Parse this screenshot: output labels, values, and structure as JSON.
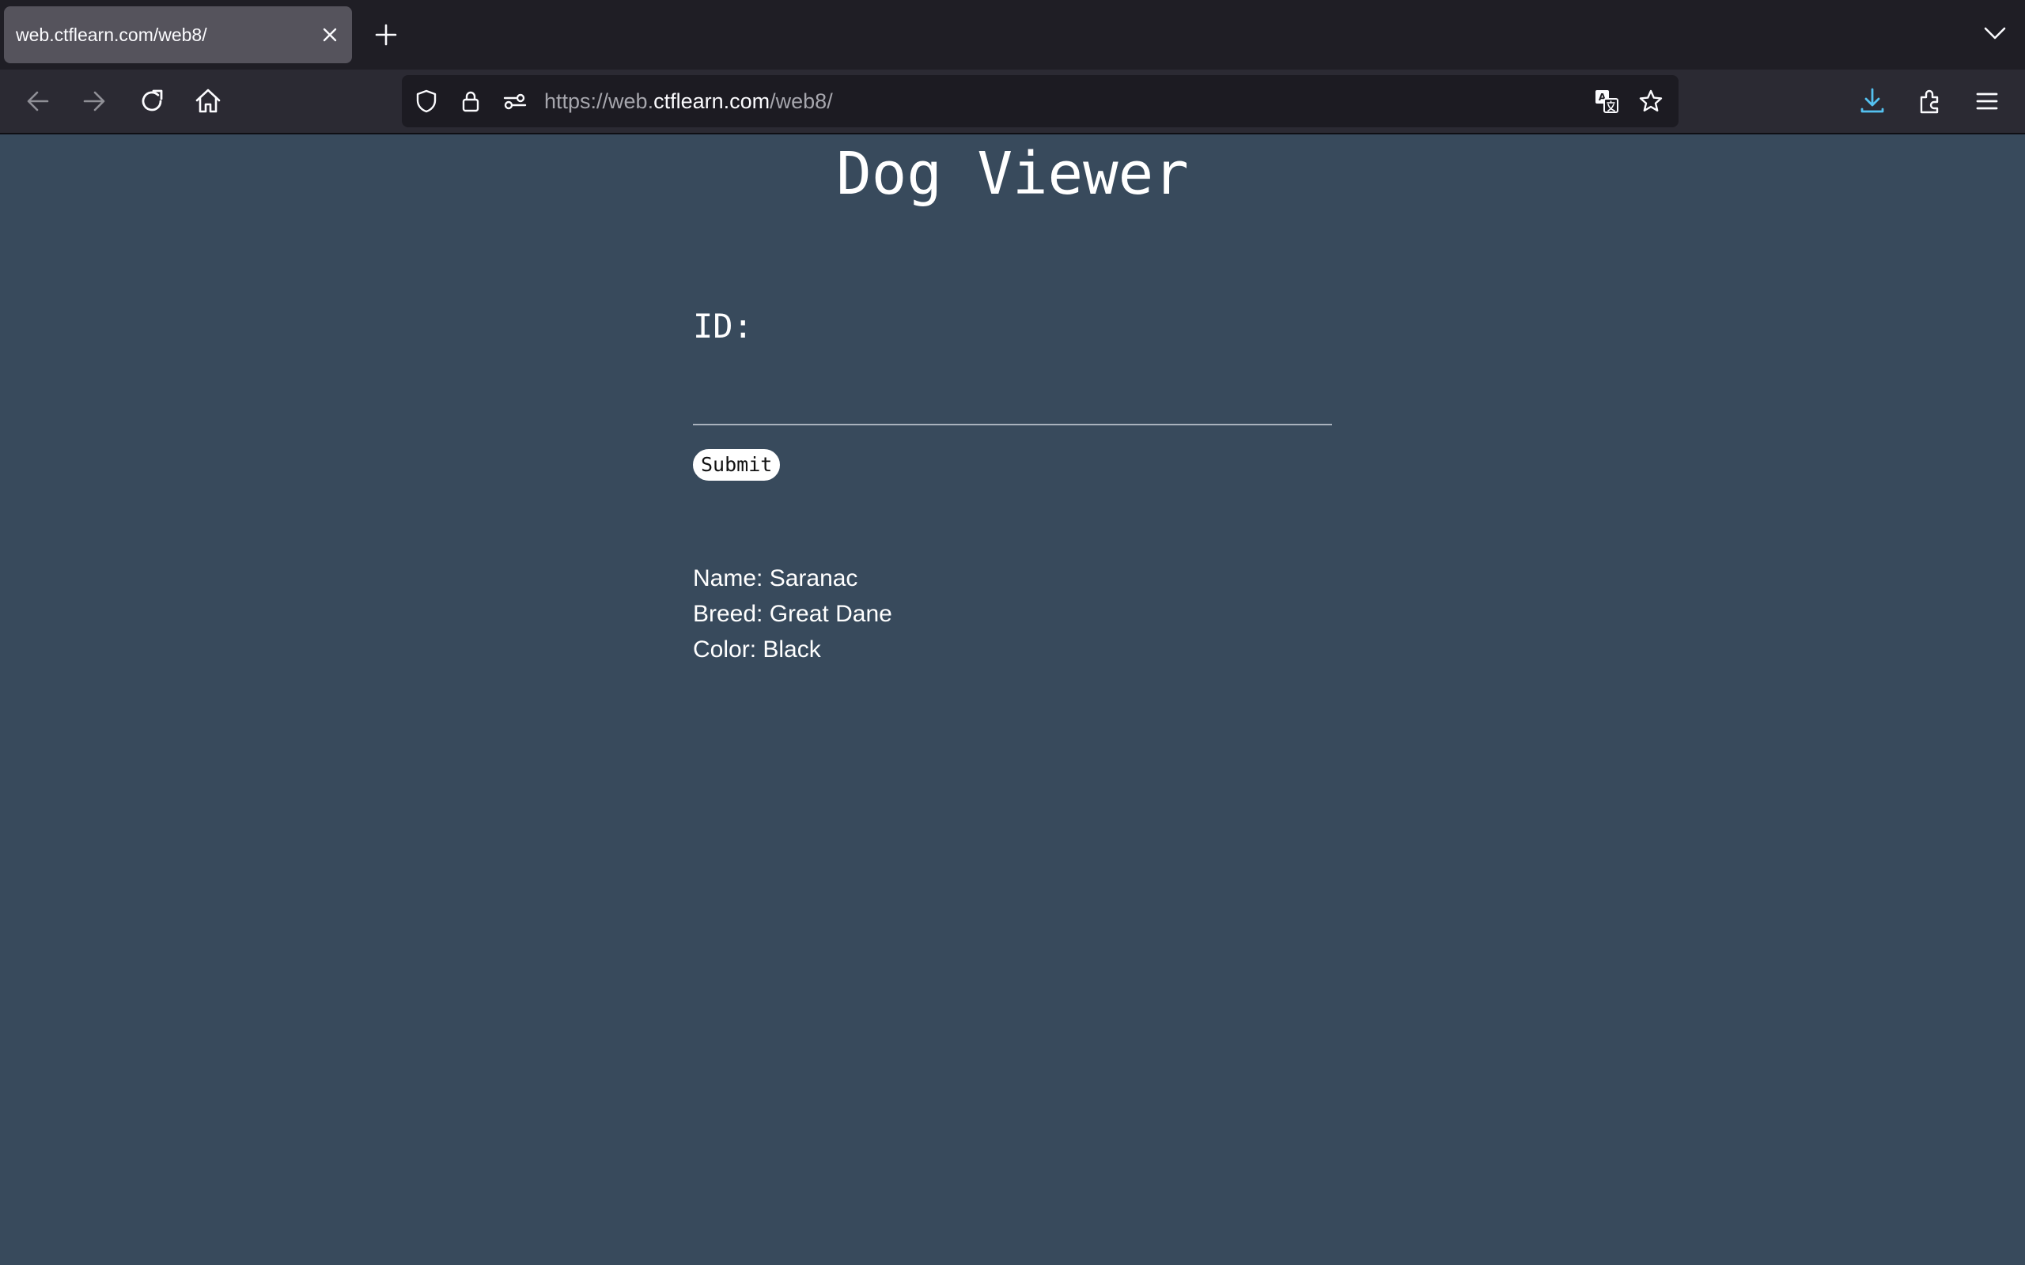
{
  "browser": {
    "tab_title": "web.ctflearn.com/web8/",
    "url_scheme": "https://web.",
    "url_host": "ctflearn.com",
    "url_path": "/web8/"
  },
  "page": {
    "title": "Dog Viewer",
    "id_label": "ID:",
    "id_value": "",
    "submit_label": "Submit",
    "result": {
      "name": "Name: Saranac",
      "breed": "Breed: Great Dane",
      "color": "Color: Black"
    }
  },
  "colors": {
    "page_bg": "#384a5c",
    "tabbar_bg": "#1f1e25",
    "navbar_bg": "#2b2a33",
    "download_accent": "#54c1f0"
  }
}
